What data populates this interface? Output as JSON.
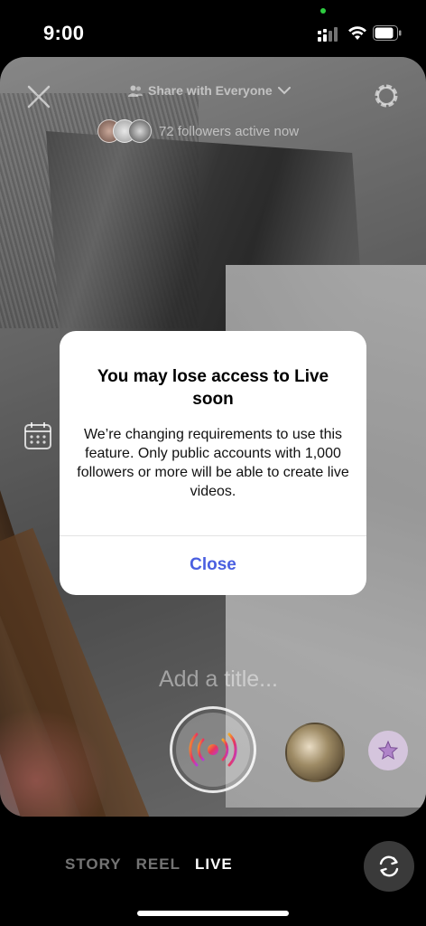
{
  "status_bar": {
    "time": "9:00",
    "camera_indicator_color": "#2ecc40"
  },
  "camera": {
    "close_icon": "close-icon",
    "share": {
      "label": "Share with Everyone",
      "icon": "people-icon",
      "chevron": "chevron-down-icon"
    },
    "followers_active": "72 followers active now",
    "settings_icon": "gear-icon",
    "schedule_icon": "calendar-icon",
    "title_placeholder": "Add a title...",
    "record_icon": "live-broadcast-icon",
    "effects_icon": "star-icon"
  },
  "modal": {
    "title": "You may lose access to Live soon",
    "body": "We’re changing requirements to use this feature. Only public accounts with 1,000 followers or more will be able to create live videos.",
    "close_label": "Close",
    "close_color": "#4a5fe0"
  },
  "modes": {
    "items": [
      "STORY",
      "REEL",
      "LIVE"
    ],
    "active": "LIVE"
  },
  "flip_camera_icon": "flip-camera-icon"
}
